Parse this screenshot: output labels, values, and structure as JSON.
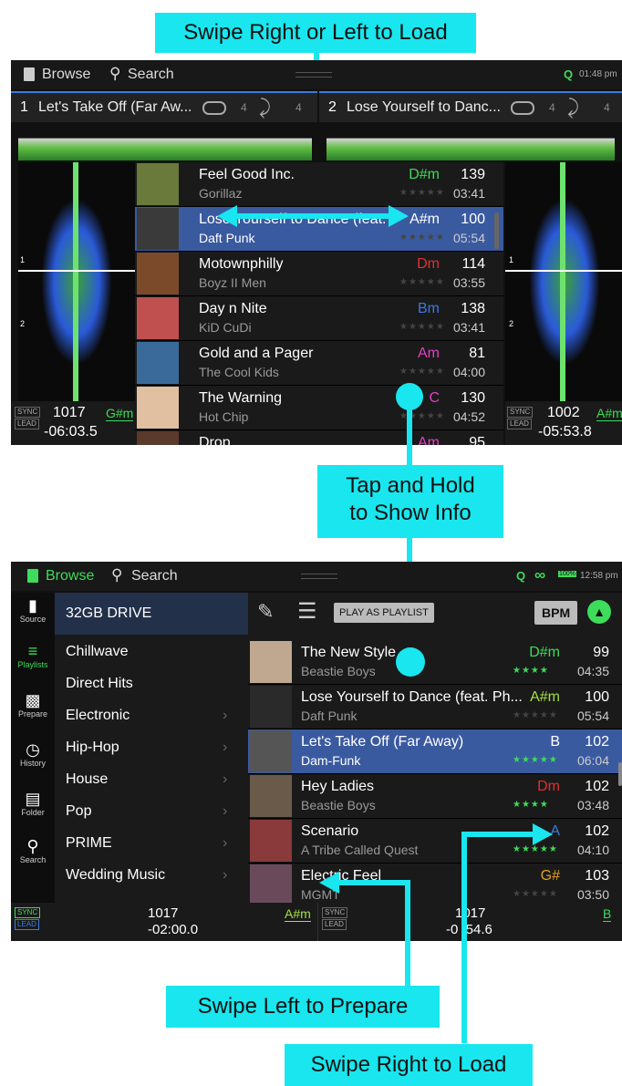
{
  "callouts": {
    "swipe_load": "Swipe Right or Left to Load",
    "tap_hold_l1": "Tap and Hold",
    "tap_hold_l2": "to Show Info",
    "swipe_prepare": "Swipe Left to Prepare",
    "swipe_right": "Swipe Right to Load"
  },
  "screen1": {
    "browse": "Browse",
    "search": "Search",
    "q_label": "Q",
    "time": "01:48 pm",
    "deck1": {
      "num": "1",
      "title": "Let's Take Off (Far Aw...",
      "loop": "4",
      "jump": "4",
      "bpm": "1017",
      "key": "G#m",
      "time": "-06:03.5",
      "sync": "SYNC",
      "lead": "LEAD",
      "marker": "1",
      "marker2": "2"
    },
    "deck2": {
      "num": "2",
      "title": "Lose Yourself to Danc...",
      "loop": "4",
      "jump": "4",
      "bpm": "1002",
      "key": "A#m",
      "time": "-05:53.8",
      "sync": "SYNC",
      "lead": "LEAD",
      "marker": "1",
      "marker2": "2"
    },
    "tracks": [
      {
        "title": "Feel Good Inc.",
        "artist": "Gorillaz",
        "key": "D#m",
        "key_color": "#3ddc5a",
        "bpm": "139",
        "dur": "03:41"
      },
      {
        "title": "Lose Yourself to Dance (feat. P",
        "artist": "Daft Punk",
        "key": "A#m",
        "key_color": "#ffffff",
        "bpm": "100",
        "dur": "05:54"
      },
      {
        "title": "Motownphilly",
        "artist": "Boyz II Men",
        "key": "Dm",
        "key_color": "#e03030",
        "bpm": "114",
        "dur": "03:55"
      },
      {
        "title": "Day n Nite",
        "artist": "KiD CuDi",
        "key": "Bm",
        "key_color": "#3a7ae0",
        "bpm": "138",
        "dur": "03:41"
      },
      {
        "title": "Gold and a Pager",
        "artist": "The Cool Kids",
        "key": "Am",
        "key_color": "#e040c0",
        "bpm": "81",
        "dur": "04:00"
      },
      {
        "title": "The Warning",
        "artist": "Hot Chip",
        "key": "C",
        "key_color": "#e040c0",
        "bpm": "130",
        "dur": "04:52"
      },
      {
        "title": "Drop",
        "artist": "",
        "key": "Am",
        "key_color": "#e040c0",
        "bpm": "95",
        "dur": ""
      }
    ],
    "stars": "★★★★★"
  },
  "screen2": {
    "browse": "Browse",
    "search": "Search",
    "q_label": "Q",
    "battery": "100%",
    "time": "12:58 pm",
    "sidebar": [
      {
        "label": "Source",
        "icon": "usb-icon"
      },
      {
        "label": "Playlists",
        "icon": "playlist-icon"
      },
      {
        "label": "Prepare",
        "icon": "prepare-icon"
      },
      {
        "label": "History",
        "icon": "clock-icon"
      },
      {
        "label": "Folder",
        "icon": "folder-icon"
      },
      {
        "label": "Search",
        "icon": "search-icon"
      }
    ],
    "drive": "32GB DRIVE",
    "play_as_playlist": "PLAY AS PLAYLIST",
    "bpm_button": "BPM",
    "categories": [
      "Chillwave",
      "Direct Hits",
      "Electronic",
      "Hip-Hop",
      "House",
      "Pop",
      "PRIME",
      "Wedding Music"
    ],
    "tracks": [
      {
        "title": "The New Style",
        "artist": "Beastie Boys",
        "key": "D#m",
        "key_color": "#3ddc5a",
        "bpm": "99",
        "dur": "04:35",
        "stars": "★★★★",
        "star_color": "#3ddc5a"
      },
      {
        "title": "Lose Yourself to Dance (feat. Ph...",
        "artist": "Daft Punk",
        "key": "A#m",
        "key_color": "#a0e040",
        "bpm": "100",
        "dur": "05:54",
        "stars": "★★★★★",
        "star_color": "#444444"
      },
      {
        "title": "Let's Take Off (Far Away)",
        "artist": "Dam-Funk",
        "key": "B",
        "key_color": "#ffffff",
        "bpm": "102",
        "dur": "06:04",
        "stars": "★★★★★",
        "star_color": "#3ddc5a"
      },
      {
        "title": "Hey Ladies",
        "artist": "Beastie Boys",
        "key": "Dm",
        "key_color": "#e03030",
        "bpm": "102",
        "dur": "03:48",
        "stars": "★★★★",
        "star_color": "#3ddc5a"
      },
      {
        "title": "Scenario",
        "artist": "A Tribe Called Quest",
        "key": "A",
        "key_color": "#3a7ae0",
        "bpm": "102",
        "dur": "04:10",
        "stars": "★★★★★",
        "star_color": "#3ddc5a"
      },
      {
        "title": "Electric Feel",
        "artist": "MGMT",
        "key": "G#",
        "key_color": "#e0a020",
        "bpm": "103",
        "dur": "03:50",
        "stars": "★★★★★",
        "star_color": "#444444"
      }
    ],
    "deck1": {
      "sync": "SYNC",
      "lead": "LEAD",
      "bpm": "1017",
      "time": "-02:00.0",
      "key": "A#m"
    },
    "deck2": {
      "sync": "SYNC",
      "lead": "LEAD",
      "bpm": "1017",
      "time": "-0 :54.6",
      "key": "B"
    }
  }
}
